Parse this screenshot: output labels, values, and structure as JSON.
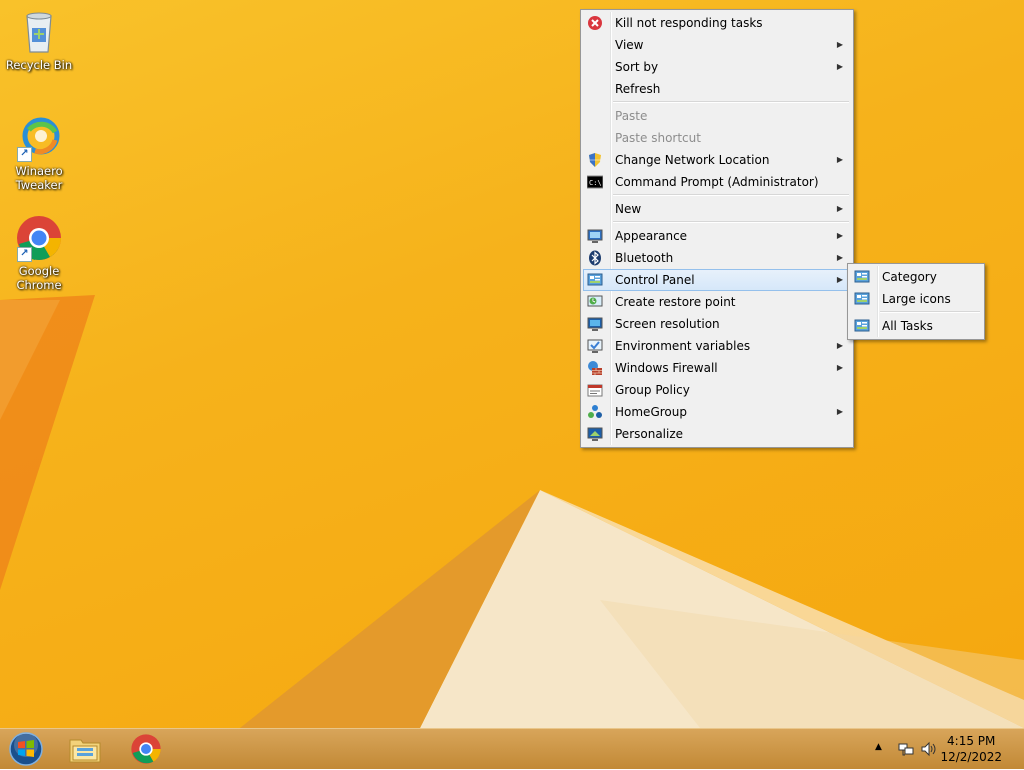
{
  "desktop": {
    "icons": [
      {
        "label": "Recycle Bin",
        "icon": "recycle-bin-icon"
      },
      {
        "label": "Winaero Tweaker",
        "icon": "winaero-tweaker-icon"
      },
      {
        "label": "Google Chrome",
        "icon": "chrome-icon"
      }
    ]
  },
  "context_menu": {
    "items": [
      {
        "label": "Kill not responding tasks",
        "icon": "kill-tasks-icon"
      },
      {
        "label": "View",
        "submenu": true
      },
      {
        "label": "Sort by",
        "submenu": true
      },
      {
        "label": "Refresh"
      },
      {
        "label": "Paste",
        "disabled": true
      },
      {
        "label": "Paste shortcut",
        "disabled": true
      },
      {
        "label": "Change Network Location",
        "icon": "uac-shield-icon",
        "submenu": true
      },
      {
        "label": "Command Prompt (Administrator)",
        "icon": "cmd-icon"
      },
      {
        "label": "New",
        "submenu": true
      },
      {
        "label": "Appearance",
        "icon": "appearance-icon",
        "submenu": true
      },
      {
        "label": "Bluetooth",
        "icon": "bluetooth-icon",
        "submenu": true
      },
      {
        "label": "Control Panel",
        "icon": "control-panel-icon",
        "submenu": true,
        "highlighted": true
      },
      {
        "label": "Create restore point",
        "icon": "restore-point-icon"
      },
      {
        "label": "Screen resolution",
        "icon": "screen-resolution-icon"
      },
      {
        "label": "Environment variables",
        "icon": "environment-variables-icon",
        "submenu": true
      },
      {
        "label": "Windows Firewall",
        "icon": "firewall-icon",
        "submenu": true
      },
      {
        "label": "Group Policy",
        "icon": "group-policy-icon"
      },
      {
        "label": "HomeGroup",
        "icon": "homegroup-icon",
        "submenu": true
      },
      {
        "label": "Personalize",
        "icon": "personalize-icon"
      }
    ]
  },
  "control_panel_submenu": {
    "items": [
      {
        "label": "Category",
        "icon": "control-panel-icon"
      },
      {
        "label": "Large icons",
        "icon": "control-panel-icon"
      },
      {
        "label": "All Tasks",
        "icon": "control-panel-icon"
      }
    ]
  },
  "taskbar": {
    "start": "start-orb-icon",
    "pinned": [
      "file-explorer-icon",
      "chrome-icon"
    ],
    "tray": {
      "show_hidden_icon": "up-arrow-icon",
      "network_icon": "network-icon",
      "volume_icon": "volume-icon",
      "time": "4:15 PM",
      "date": "12/2/2022"
    }
  },
  "colors": {
    "wallpaper": "#f6b21b",
    "taskbar": "#c8913f",
    "menu_bg": "#f0f0f0",
    "menu_highlight": "#d5e7f9"
  }
}
